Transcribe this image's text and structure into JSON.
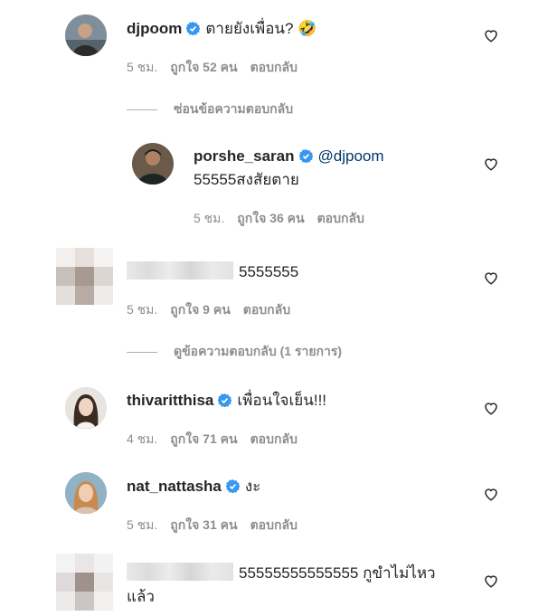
{
  "comments": [
    {
      "username": "djpoom",
      "text": "ตายยังเพื่อน? 🤣",
      "time": "5 ชม.",
      "likes": "ถูกใจ 52 คน",
      "reply": "ตอบกลับ",
      "thread_toggle": "ซ่อนข้อความตอบกลับ"
    },
    {
      "username": "porshe_saran",
      "mention": "@djpoom",
      "text": "55555สงสัยตาย",
      "time": "5 ชม.",
      "likes": "ถูกใจ 36 คน",
      "reply": "ตอบกลับ"
    },
    {
      "text": "5555555",
      "time": "5 ชม.",
      "likes": "ถูกใจ 9 คน",
      "reply": "ตอบกลับ",
      "thread_toggle": "ดูข้อความตอบกลับ (1 รายการ)"
    },
    {
      "username": "thivaritthisa",
      "text": "เพื่อนใจเย็น!!!",
      "time": "4 ชม.",
      "likes": "ถูกใจ 71 คน",
      "reply": "ตอบกลับ"
    },
    {
      "username": "nat_nattasha",
      "text": "งะ",
      "time": "5 ชม.",
      "likes": "ถูกใจ 31 คน",
      "reply": "ตอบกลับ"
    },
    {
      "text_line1": "55555555555555 กูขำไม่ไหว",
      "text_line2": "แล้ว"
    }
  ],
  "colors": {
    "verified": "#3897f0",
    "meta_text": "#8e8e8e",
    "mention": "#00376b"
  },
  "icons": {
    "verified": "verified-badge-icon",
    "like": "heart-outline-icon"
  }
}
